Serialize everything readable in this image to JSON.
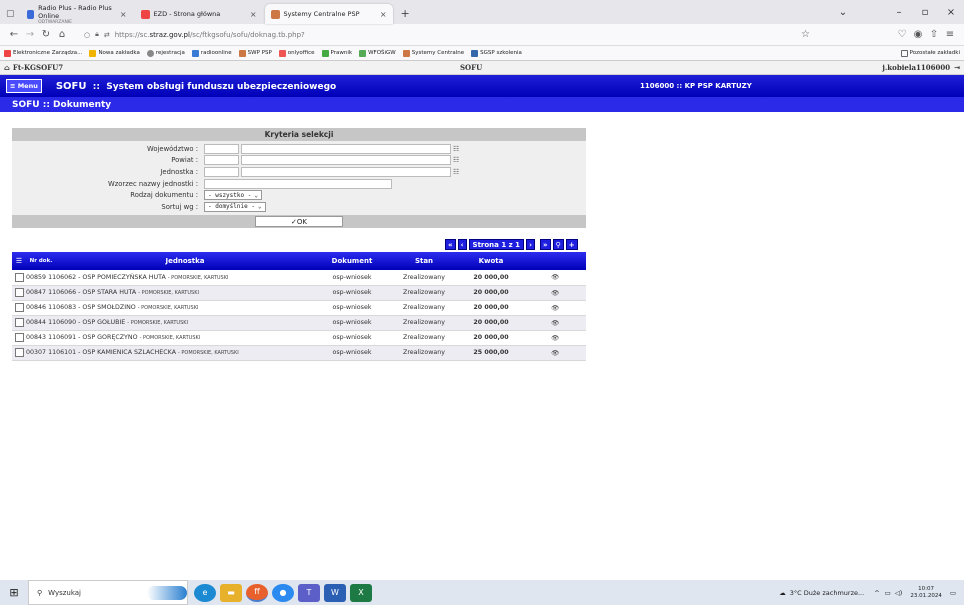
{
  "browser": {
    "tabs": [
      {
        "title": "Radio Plus - Radio Plus Online",
        "subtitle": "ODTWARZANIE",
        "color": "#3a6bd8"
      },
      {
        "title": "EZD - Strona główna",
        "color": "#e44"
      },
      {
        "title": "Systemy Centralne PSP",
        "color": "#c74",
        "active": true
      }
    ],
    "new_tab": "+",
    "url_prefix": "https://sc.",
    "url_domain": "straz.gov.pl",
    "url_path": "/sc/ftkgsofu/sofu/doknag.tb.php?",
    "bookmarks": [
      "Elektroniczne Zarządza...",
      "Nowa zakładka",
      "rejestracja",
      "radioonline",
      "SWP PSP",
      "onlyoffice",
      "Prawnik",
      "WFOŚiGW",
      "Systemy Centralne",
      "SGSP szkolenia"
    ],
    "bookmarks_other": "Pozostałe zakładki"
  },
  "app": {
    "top_left": "Ft-KGSOFU7",
    "top_mid": "SOFU",
    "user": "j.kobiela1106000",
    "menu": "≡ Menu",
    "title_short": "SOFU",
    "title_sep": "::",
    "title_long": "System obsługi funduszu ubezpieczeniowego",
    "unit": "1106000 :: KP PSP KARTUZY",
    "page_title": "SOFU :: Dokumenty"
  },
  "criteria": {
    "caption": "Kryteria selekcji",
    "fields": [
      {
        "label": "Województwo :"
      },
      {
        "label": "Powiat :"
      },
      {
        "label": "Jednostka :"
      },
      {
        "label": "Wzorzec nazwy jednostki :"
      }
    ],
    "doc_type_label": "Rodzaj dokumentu :",
    "doc_type_value": "- wszystko -",
    "sort_label": "Sortuj wg :",
    "sort_value": "- domyślnie -",
    "ok": "✓OK"
  },
  "pager": {
    "page_text": "Strona 1 z 1"
  },
  "table": {
    "headers": {
      "nr": "Nr dok.",
      "unit": "Jednostka",
      "doc": "Dokument",
      "status": "Stan",
      "amount": "Kwota"
    },
    "rows": [
      {
        "nr": "00859",
        "unit": "1106062 - OSP POMIECZYŃSKA HUTA",
        "region": "- POMORSKIE, KARTUSKI",
        "doc": "osp-wniosek",
        "status": "Zrealizowany",
        "amount": "20 000,00"
      },
      {
        "nr": "00847",
        "unit": "1106066 - OSP STARA HUTA",
        "region": "- POMORSKIE, KARTUSKI",
        "doc": "osp-wniosek",
        "status": "Zrealizowany",
        "amount": "20 000,00"
      },
      {
        "nr": "00846",
        "unit": "1106083 - OSP SMOŁDZINO",
        "region": "- POMORSKIE, KARTUSKI",
        "doc": "osp-wniosek",
        "status": "Zrealizowany",
        "amount": "20 000,00"
      },
      {
        "nr": "00844",
        "unit": "1106090 - OSP GOŁUBIE",
        "region": "- POMORSKIE, KARTUSKI",
        "doc": "osp-wniosek",
        "status": "Zrealizowany",
        "amount": "20 000,00"
      },
      {
        "nr": "00843",
        "unit": "1106091 - OSP GORĘCZYNO",
        "region": "- POMORSKIE, KARTUSKI",
        "doc": "osp-wniosek",
        "status": "Zrealizowany",
        "amount": "20 000,00"
      },
      {
        "nr": "00307",
        "unit": "1106101 - OSP KAMIENICA SZLACHECKA",
        "region": "- POMORSKIE, KARTUSKI",
        "doc": "osp-wniosek",
        "status": "Zrealizowany",
        "amount": "25 000,00"
      }
    ]
  },
  "taskbar": {
    "search": "Wyszukaj",
    "weather": "3°C Duże zachmurze...",
    "time": "10:07",
    "date": "23.01.2024"
  }
}
